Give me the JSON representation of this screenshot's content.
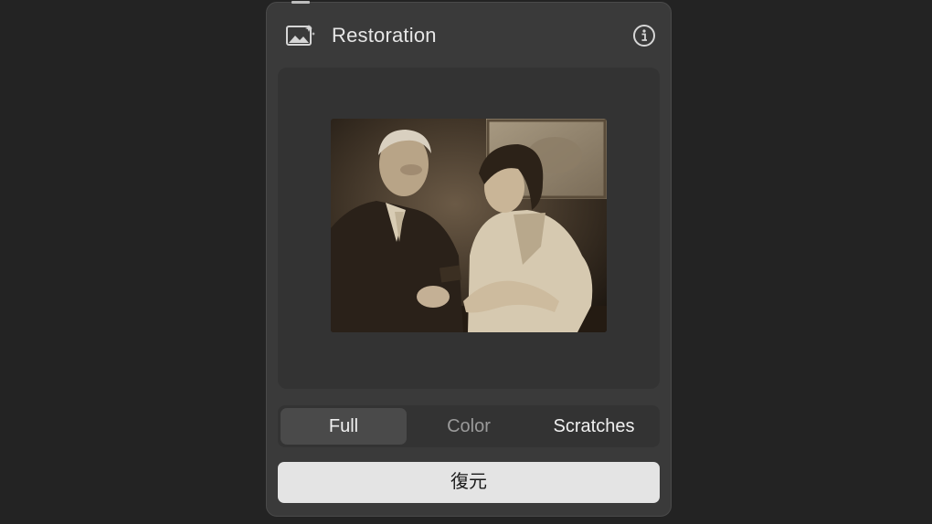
{
  "panel": {
    "title": "Restoration",
    "header_icon": "photo-sparkle-icon",
    "info_icon": "info-icon"
  },
  "preview": {
    "image": "restoration-preview-photo"
  },
  "modes": {
    "items": [
      {
        "label": "Full",
        "selected": true
      },
      {
        "label": "Color",
        "selected": false
      },
      {
        "label": "Scratches",
        "selected": false
      }
    ]
  },
  "action": {
    "restore_label": "復元"
  },
  "colors": {
    "background": "#232323",
    "panel": "#3a3a3a",
    "well": "#333333",
    "selected_segment": "#4a4a4a",
    "button": "#e4e4e4"
  }
}
